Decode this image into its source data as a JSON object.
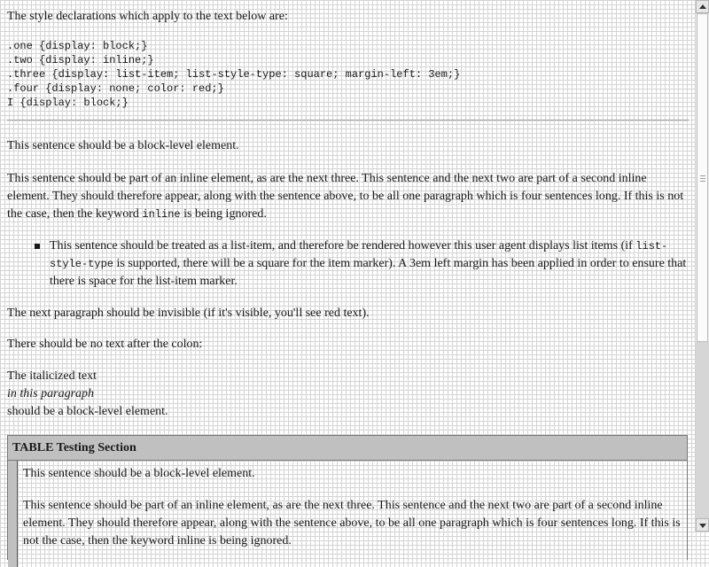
{
  "intro": "The style declarations which apply to the text below are:",
  "rules": [
    ".one {display: block;}",
    ".two {display: inline;}",
    ".three {display: list-item; list-style-type: square; margin-left: 3em;}",
    ".four {display: none; color: red;}",
    "I {display: block;}"
  ],
  "p1": "This sentence should be a block-level element.",
  "p2": {
    "before": "This sentence should be part of an inline element, as are the next three. This sentence and the next two are part of a second inline element. They should therefore appear, along with the sentence above, to be all one paragraph which is four sentences long. If this is not the case, then the keyword ",
    "code": "inline",
    "after": " is being ignored."
  },
  "li": {
    "before": "This sentence should be treated as a list-item, and therefore be rendered however this user agent displays list items (if ",
    "code": "list-style-type",
    "after": " is supported, there will be a square for the item marker). A 3em left margin has been applied in order to ensure that there is space for the list-item marker."
  },
  "p4": "The next paragraph should be invisible (if it's visible, you'll see red text).",
  "p5": "There should be no text after the colon:",
  "p6": {
    "line1": "The italicized text",
    "italic": "in this paragraph",
    "line3": "should be a block-level element."
  },
  "table": {
    "header": "TABLE Testing Section",
    "t1": "This sentence should be a block-level element.",
    "t2": "This sentence should be part of an inline element, as are the next three. This sentence and the next two are part of a second inline element. They should therefore appear, along with the sentence above, to be all one paragraph which is four sentences long. If this is not the case, then the keyword inline is being ignored."
  },
  "scrollbar": {
    "thumb_fraction": 0.65
  }
}
